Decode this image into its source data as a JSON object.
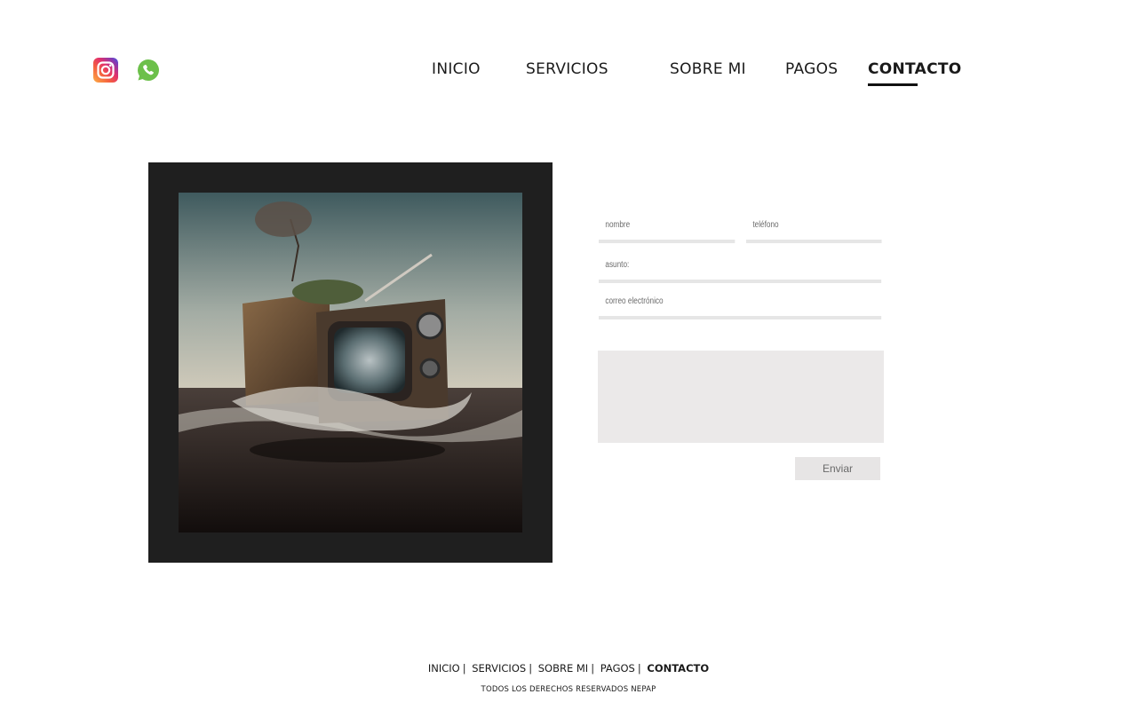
{
  "social": {
    "instagram_icon": "instagram-icon",
    "whatsapp_icon": "whatsapp-icon",
    "whatsapp_color": "#6cc04a"
  },
  "nav": {
    "items": [
      {
        "label": "INICIO"
      },
      {
        "label": "SERVICIOS"
      },
      {
        "label": "SOBRE MI"
      },
      {
        "label": "PAGOS"
      },
      {
        "label": "CONTACTO"
      }
    ],
    "active": "CONTACTO"
  },
  "hero": {
    "frame_color": "#1f1f1f"
  },
  "form": {
    "name_placeholder": "nombre",
    "phone_placeholder": "teléfono",
    "subject_placeholder": "asunto:",
    "email_placeholder": "correo electrónico",
    "message_value": "",
    "submit_label": "Enviar"
  },
  "footer": {
    "items": [
      {
        "label": "INICIO"
      },
      {
        "label": "SERVICIOS"
      },
      {
        "label": "SOBRE MI"
      },
      {
        "label": "PAGOS"
      },
      {
        "label": "CONTACTO"
      }
    ],
    "separator": "|",
    "copyright": "TODOS LOS DERECHOS RESERVADOS  NEPAP"
  }
}
